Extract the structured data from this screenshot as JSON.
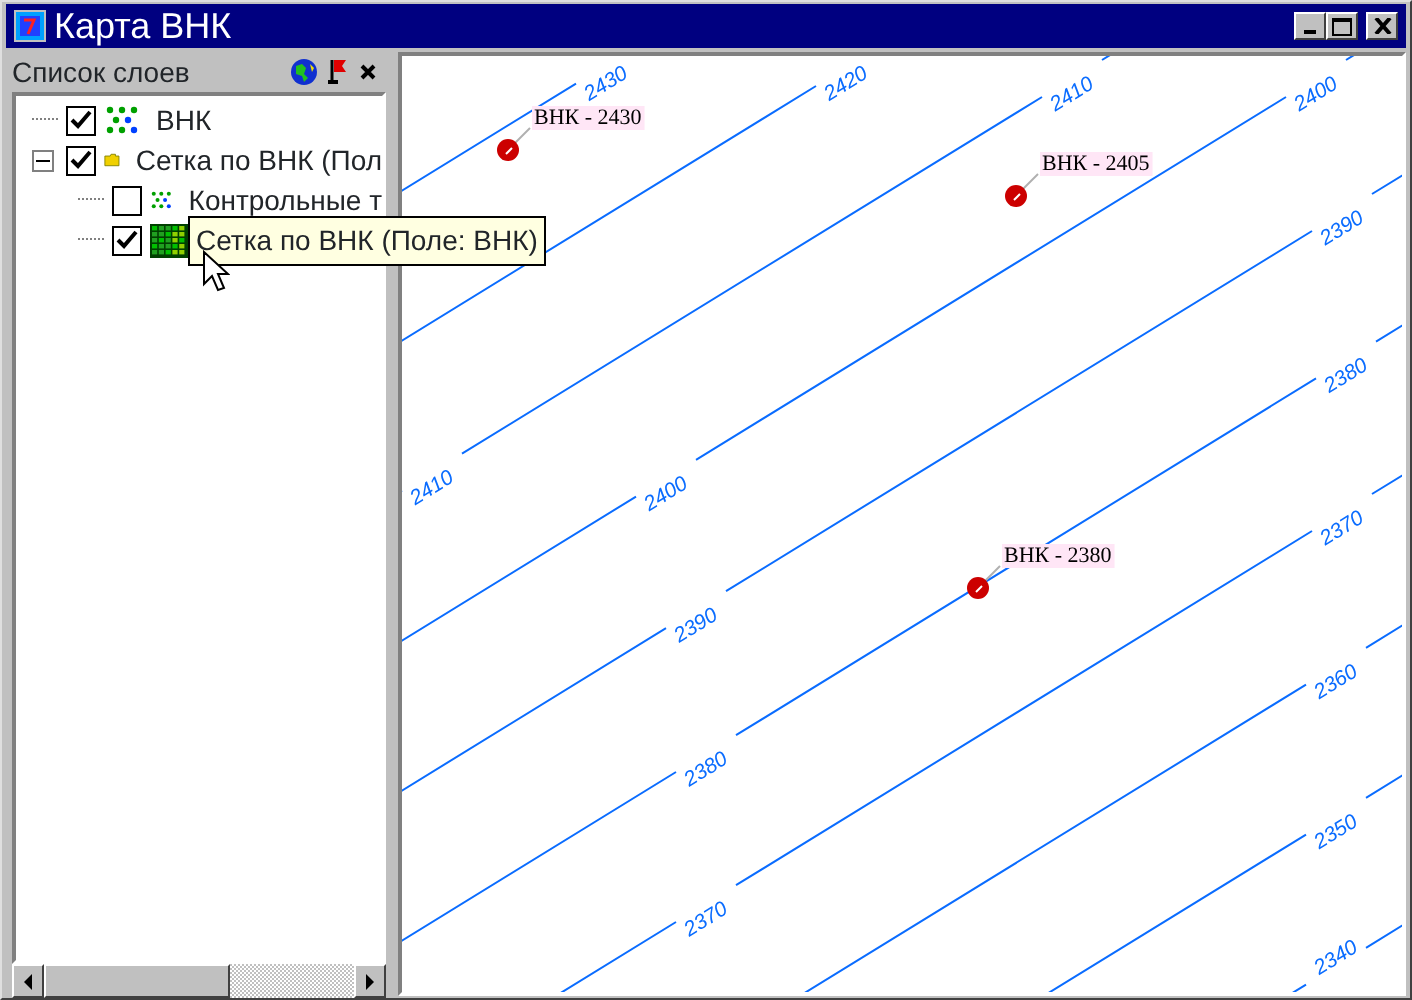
{
  "window": {
    "title": "Карта ВНК"
  },
  "layers_panel": {
    "title": "Список слоев",
    "tree": [
      {
        "label": "ВНК",
        "kind": "points",
        "checked": true
      },
      {
        "label": "Сетка по ВНК (Пол",
        "kind": "folder",
        "checked": true,
        "expanded": true,
        "children": [
          {
            "label": "Контрольные т",
            "kind": "points",
            "checked": false
          },
          {
            "kind": "grid",
            "checked": true
          }
        ]
      }
    ],
    "tooltip": "Сетка по ВНК (Поле: ВНК)"
  },
  "map": {
    "contours": [
      {
        "labels": [
          "2430"
        ]
      },
      {
        "labels": [
          "2420"
        ]
      },
      {
        "labels": [
          "2410",
          "2410"
        ]
      },
      {
        "labels": [
          "2400",
          "2400"
        ]
      },
      {
        "labels": [
          "2390",
          "2390"
        ]
      },
      {
        "labels": [
          "2380",
          "2380"
        ]
      },
      {
        "labels": [
          "2370",
          "2370"
        ]
      },
      {
        "labels": [
          "2360"
        ]
      },
      {
        "labels": [
          "2350"
        ]
      },
      {
        "labels": [
          "2340"
        ]
      }
    ],
    "wells": [
      {
        "label": "ВНК - 2430"
      },
      {
        "label": "ВНК - 2405"
      },
      {
        "label": "ВНК - 2380"
      }
    ]
  }
}
